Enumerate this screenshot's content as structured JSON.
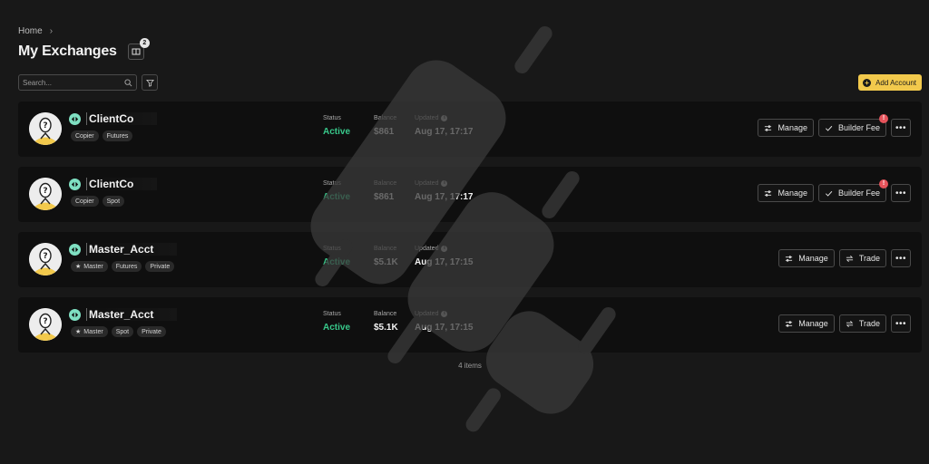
{
  "breadcrumb": {
    "home": "Home",
    "separator": "›"
  },
  "page": {
    "title": "My Exchanges",
    "book_count": "2"
  },
  "toolbar": {
    "search_placeholder": "Search...",
    "add_label": "Add Account"
  },
  "columns": {
    "status": "Status",
    "balance": "Balance",
    "updated": "Updated"
  },
  "accounts": [
    {
      "name": "ClientCo",
      "tags": [
        "Copier",
        "Futures"
      ],
      "status": "Active",
      "balance": "$861",
      "updated": "Aug 17, 17:17",
      "manage": "Manage",
      "secondary": "Builder Fee",
      "alert": "!",
      "more": "•••"
    },
    {
      "name": "ClientCo",
      "tags": [
        "Copier",
        "Spot"
      ],
      "status": "Active",
      "balance": "$861",
      "updated": "Aug 17, 17:17",
      "manage": "Manage",
      "secondary": "Builder Fee",
      "alert": "!",
      "more": "•••"
    },
    {
      "name": "Master_Acct",
      "tags": [
        "Master",
        "Futures",
        "Private"
      ],
      "status": "Active",
      "balance": "$5.1K",
      "updated": "Aug 17, 17:15",
      "manage": "Manage",
      "secondary": "Trade",
      "more": "•••"
    },
    {
      "name": "Master_Acct",
      "tags": [
        "Master",
        "Spot",
        "Private"
      ],
      "status": "Active",
      "balance": "$5.1K",
      "updated": "Aug 17, 17:15",
      "manage": "Manage",
      "secondary": "Trade",
      "more": "•••"
    }
  ],
  "footer": {
    "count": "4 items"
  },
  "colors": {
    "accent": "#f2c94c",
    "active": "#38c98b",
    "alert": "#e5535b",
    "exchange": "#7fe0c2"
  }
}
